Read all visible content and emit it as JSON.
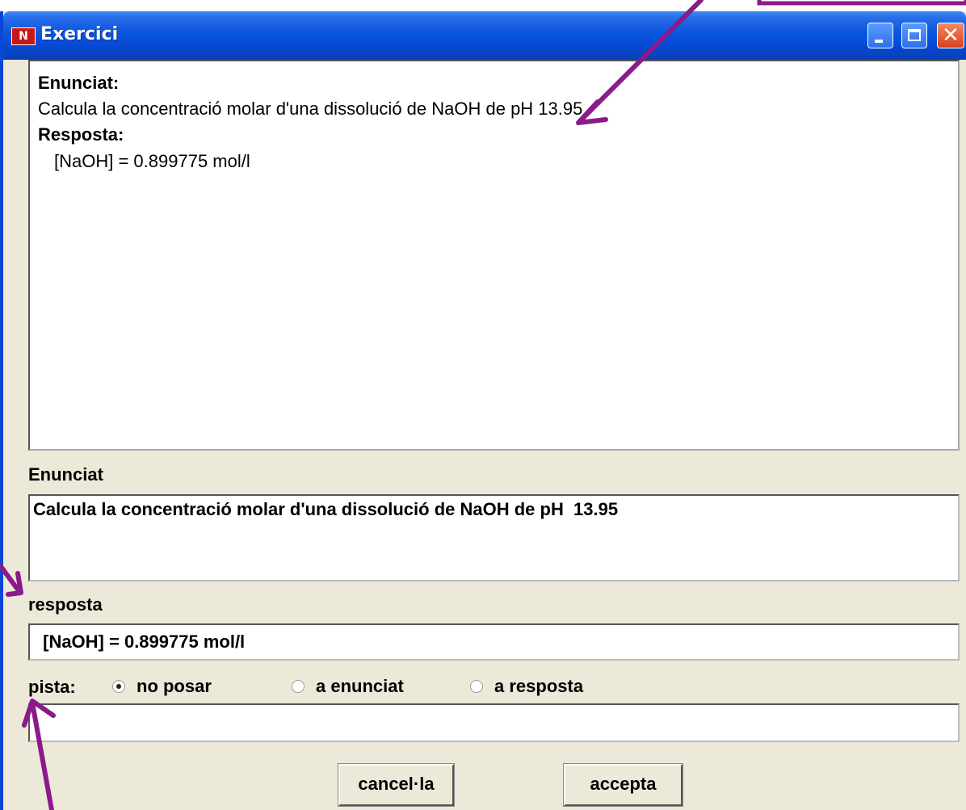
{
  "window": {
    "title": "Exercici",
    "icon": "app-logo-icon"
  },
  "preview": {
    "statement_label": "Enunciat:",
    "statement_text": "Calcula la concentració molar d'una dissolució de NaOH de pH  13.95",
    "answer_label": "Resposta:",
    "answer_text": "[NaOH] = 0.899775 mol/l"
  },
  "form": {
    "statement_label": "Enunciat",
    "statement_value": "Calcula la concentració molar d'una dissolució de NaOH de pH  13.95",
    "answer_label": "resposta",
    "answer_value": " [NaOH] = 0.899775 mol/l",
    "hint_label": "pista:",
    "hint_options": [
      "no posar",
      "a enunciat",
      "a resposta"
    ],
    "hint_selected": "no posar",
    "hint_value": ""
  },
  "buttons": {
    "cancel": "cancel·la",
    "accept": "accepta"
  },
  "colors": {
    "annotation_arrow": "#8b1a8b",
    "titlebar": "#0a55e0",
    "window_bg": "#ece9d8"
  }
}
